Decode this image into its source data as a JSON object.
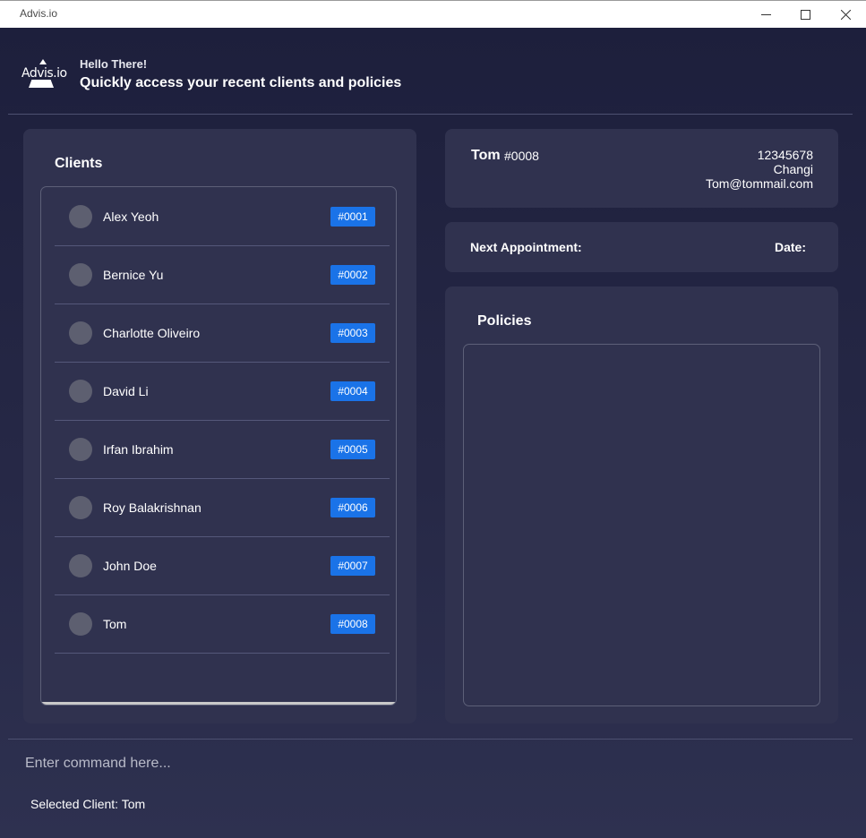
{
  "window": {
    "title": "Advis.io",
    "icon_text": "Advis.io"
  },
  "header": {
    "logo_text": "Advis.io",
    "greeting": "Hello There!",
    "subtitle": "Quickly access your recent clients and policies"
  },
  "clients": {
    "title": "Clients",
    "items": [
      {
        "name": "Alex Yeoh",
        "id": "#0001"
      },
      {
        "name": "Bernice Yu",
        "id": "#0002"
      },
      {
        "name": "Charlotte Oliveiro",
        "id": "#0003"
      },
      {
        "name": "David Li",
        "id": "#0004"
      },
      {
        "name": "Irfan Ibrahim",
        "id": "#0005"
      },
      {
        "name": "Roy Balakrishnan",
        "id": "#0006"
      },
      {
        "name": "John Doe",
        "id": "#0007"
      },
      {
        "name": "Tom",
        "id": "#0008"
      }
    ]
  },
  "selected": {
    "name": "Tom",
    "id": "#0008",
    "phone": "12345678",
    "address": "Changi",
    "email": "Tom@tommail.com"
  },
  "appointment": {
    "next_label": "Next Appointment:",
    "date_label": "Date:"
  },
  "policies": {
    "title": "Policies"
  },
  "command": {
    "placeholder": "Enter command here..."
  },
  "status": {
    "text": "Selected Client: Tom"
  },
  "colors": {
    "background": "#1f2140",
    "panel": "#30324f",
    "badge": "#1a73e8"
  }
}
